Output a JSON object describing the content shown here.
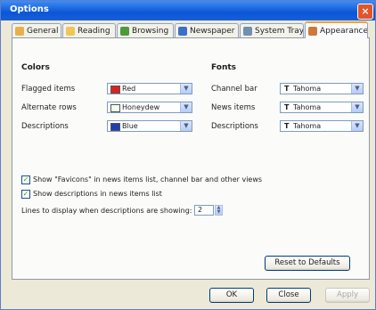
{
  "window": {
    "title": "Options",
    "close": "×"
  },
  "tabs": [
    {
      "label": "General",
      "icon": "general-icon",
      "color": "#e8b04a"
    },
    {
      "label": "Reading",
      "icon": "reading-icon",
      "color": "#f0c65a"
    },
    {
      "label": "Browsing",
      "icon": "browsing-icon",
      "color": "#4c9a3a"
    },
    {
      "label": "Newspaper",
      "icon": "newspaper-icon",
      "color": "#3b6fc9"
    },
    {
      "label": "System Tray",
      "icon": "system-tray-icon",
      "color": "#6f8fb3"
    },
    {
      "label": "Appearance",
      "icon": "appearance-icon",
      "color": "#d0783a",
      "active": true
    }
  ],
  "colors_section": {
    "title": "Colors",
    "rows": [
      {
        "label": "Flagged items",
        "value": "Red",
        "swatch": "#e02020"
      },
      {
        "label": "Alternate rows",
        "value": "Honeydew",
        "swatch": "#f0fff0"
      },
      {
        "label": "Descriptions",
        "value": "Blue",
        "swatch": "#1f3fb0"
      }
    ]
  },
  "fonts_section": {
    "title": "Fonts",
    "rows": [
      {
        "label": "Channel bar",
        "value": "Tahoma",
        "icon": "T"
      },
      {
        "label": "News items",
        "value": "Tahoma",
        "icon": "T"
      },
      {
        "label": "Descriptions",
        "value": "Tahoma",
        "icon": "T"
      }
    ]
  },
  "options": {
    "show_favicons_label": "Show \"Favicons\" in news items list, channel bar and other views",
    "show_favicons_checked": true,
    "show_descriptions_label": "Show descriptions in news items list",
    "show_descriptions_checked": true,
    "lines_label": "Lines to display when descriptions are showing:",
    "lines_value": "2"
  },
  "buttons": {
    "reset": "Reset to Defaults",
    "ok": "OK",
    "close": "Close",
    "apply": "Apply"
  },
  "accent": {
    "titlebar": "#0a56d8",
    "active_tab": "#f0a23c"
  }
}
